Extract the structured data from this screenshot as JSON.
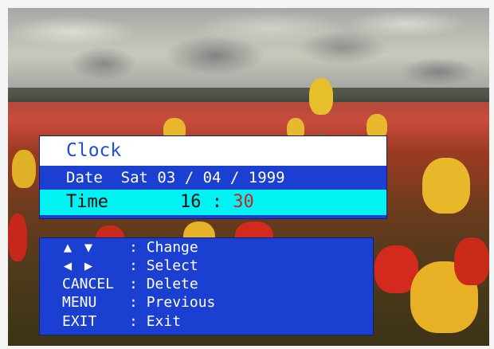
{
  "clock": {
    "title": "Clock",
    "date_label": "Date",
    "date_value": "Sat 03 / 04 / 1999",
    "time_label": "Time",
    "time_hour": "16",
    "time_sep": ":",
    "time_minute": "30"
  },
  "help": {
    "rows": [
      {
        "icons": [
          "arrow-up-icon",
          "arrow-down-icon"
        ],
        "sep": ":",
        "action": "Change"
      },
      {
        "icons": [
          "arrow-left-icon",
          "arrow-right-icon"
        ],
        "sep": ":",
        "action": "Select"
      },
      {
        "key": "CANCEL",
        "sep": ":",
        "action": "Delete"
      },
      {
        "key": "MENU",
        "sep": ":",
        "action": "Previous"
      },
      {
        "key": "EXIT",
        "sep": ":",
        "action": "Exit"
      }
    ]
  },
  "colors": {
    "panel_blue": "#1b3fd0",
    "highlight_cyan": "#00f2f2",
    "title_text": "#1f4fd8",
    "minute_red": "#d02020"
  }
}
